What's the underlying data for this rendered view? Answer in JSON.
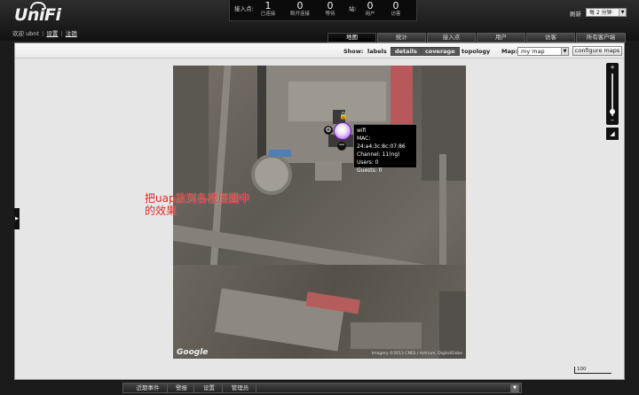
{
  "header": {
    "logo": "UniFi",
    "welcome_prefix": "欢迎 ubnt",
    "settings_link": "设置",
    "logout_link": "注销",
    "refresh_label": "刷新",
    "refresh_value": "每 2 分钟"
  },
  "stats": {
    "ap_label": "接入点:",
    "station_label": "站:",
    "items": [
      {
        "value": "1",
        "label": "已连接"
      },
      {
        "value": "0",
        "label": "断开连接"
      },
      {
        "value": "0",
        "label": "等待"
      },
      {
        "value": "0",
        "label": "用户"
      },
      {
        "value": "0",
        "label": "访客"
      }
    ]
  },
  "tabs": [
    "地图",
    "统计",
    "接入点",
    "用户",
    "访客",
    "所有客户端"
  ],
  "active_tab": "地图",
  "toolbar": {
    "show_label": "Show:",
    "labels": "labels",
    "details": "details",
    "coverage": "coverage",
    "topology": "topology",
    "map_label": "Map:",
    "map_value": "my map",
    "configure_label": "configure maps"
  },
  "map": {
    "overlay_text": "把uap放到各楼层图中的效果",
    "google": "Google",
    "copyright": "Imagery ©2013 CNES / Astrium, DigitalGlobe",
    "scale": "100"
  },
  "ap_tooltip": {
    "name": "wifi",
    "mac": "MAC: 24:a4:3c:8c:07:86",
    "channel": "Channel: 11(ng)",
    "users": "Users: 0",
    "guests": "Guests: 0"
  },
  "bottom_tabs": [
    "近期事件",
    "警报",
    "设置",
    "管理员"
  ],
  "colors": {
    "ap_accent": "#8a2be2",
    "overlay_text": "#e0201a",
    "background": "#1b1b1b",
    "content": "#e6e6e6"
  }
}
